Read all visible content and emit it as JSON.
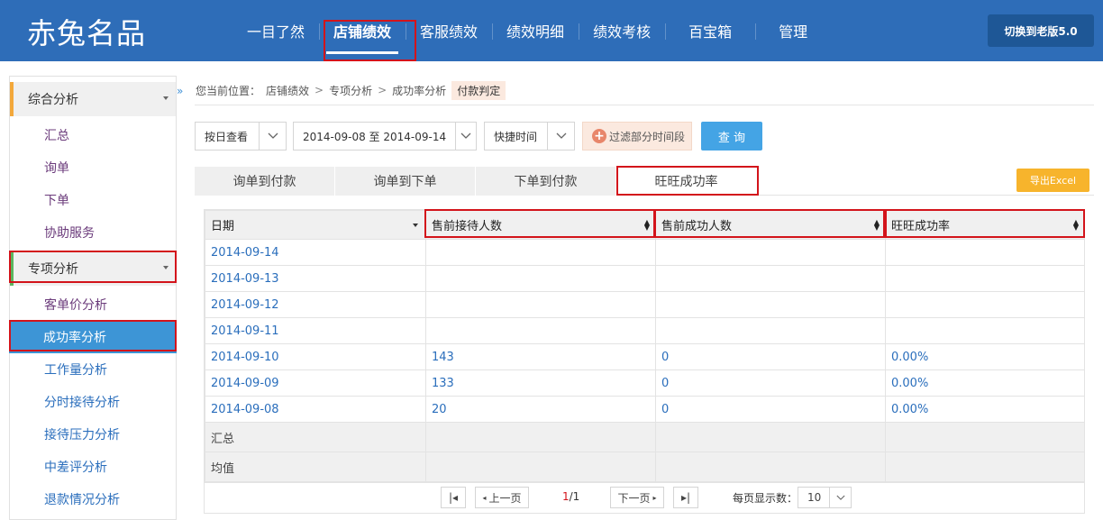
{
  "header": {
    "logo": "赤兔名品",
    "nav": [
      "一目了然",
      "店铺绩效",
      "客服绩效",
      "绩效明细",
      "绩效考核",
      "百宝箱",
      "管理"
    ],
    "active_nav": "店铺绩效",
    "switch_label": "切换到老版5.0"
  },
  "sidebar": {
    "group1": "综合分析",
    "group1_items": [
      "汇总",
      "询单",
      "下单",
      "协助服务"
    ],
    "group2": "专项分析",
    "group2_items": [
      "客单价分析",
      "成功率分析",
      "工作量分析",
      "分时接待分析",
      "接待压力分析",
      "中差评分析",
      "退款情况分析"
    ],
    "active_item": "成功率分析"
  },
  "breadcrumb": {
    "prefix": "您当前位置：",
    "items": [
      "店铺绩效",
      "专项分析",
      "成功率分析"
    ],
    "tag": "付款判定"
  },
  "filters": {
    "view_mode": "按日查看",
    "date_range": "2014-09-08 至 2014-09-14",
    "quick_time": "快捷时间",
    "filter_label": "过滤部分时间段",
    "query_label": "查 询"
  },
  "tabs": [
    "询单到付款",
    "询单到下单",
    "下单到付款",
    "旺旺成功率"
  ],
  "active_tab": "旺旺成功率",
  "export_label": "导出Excel",
  "table": {
    "columns": [
      "日期",
      "售前接待人数",
      "售前成功人数",
      "旺旺成功率"
    ],
    "rows": [
      [
        "2014-09-14",
        "",
        "",
        ""
      ],
      [
        "2014-09-13",
        "",
        "",
        ""
      ],
      [
        "2014-09-12",
        "",
        "",
        ""
      ],
      [
        "2014-09-11",
        "",
        "",
        ""
      ],
      [
        "2014-09-10",
        "143",
        "0",
        "0.00%"
      ],
      [
        "2014-09-09",
        "133",
        "0",
        "0.00%"
      ],
      [
        "2014-09-08",
        "20",
        "0",
        "0.00%"
      ]
    ],
    "summary_rows": [
      "汇总",
      "均值"
    ]
  },
  "pager": {
    "prev": "上一页",
    "page_current": "1",
    "page_total": "/1",
    "next": "下一页",
    "page_size_label": "每页显示数：",
    "page_size": "10"
  }
}
